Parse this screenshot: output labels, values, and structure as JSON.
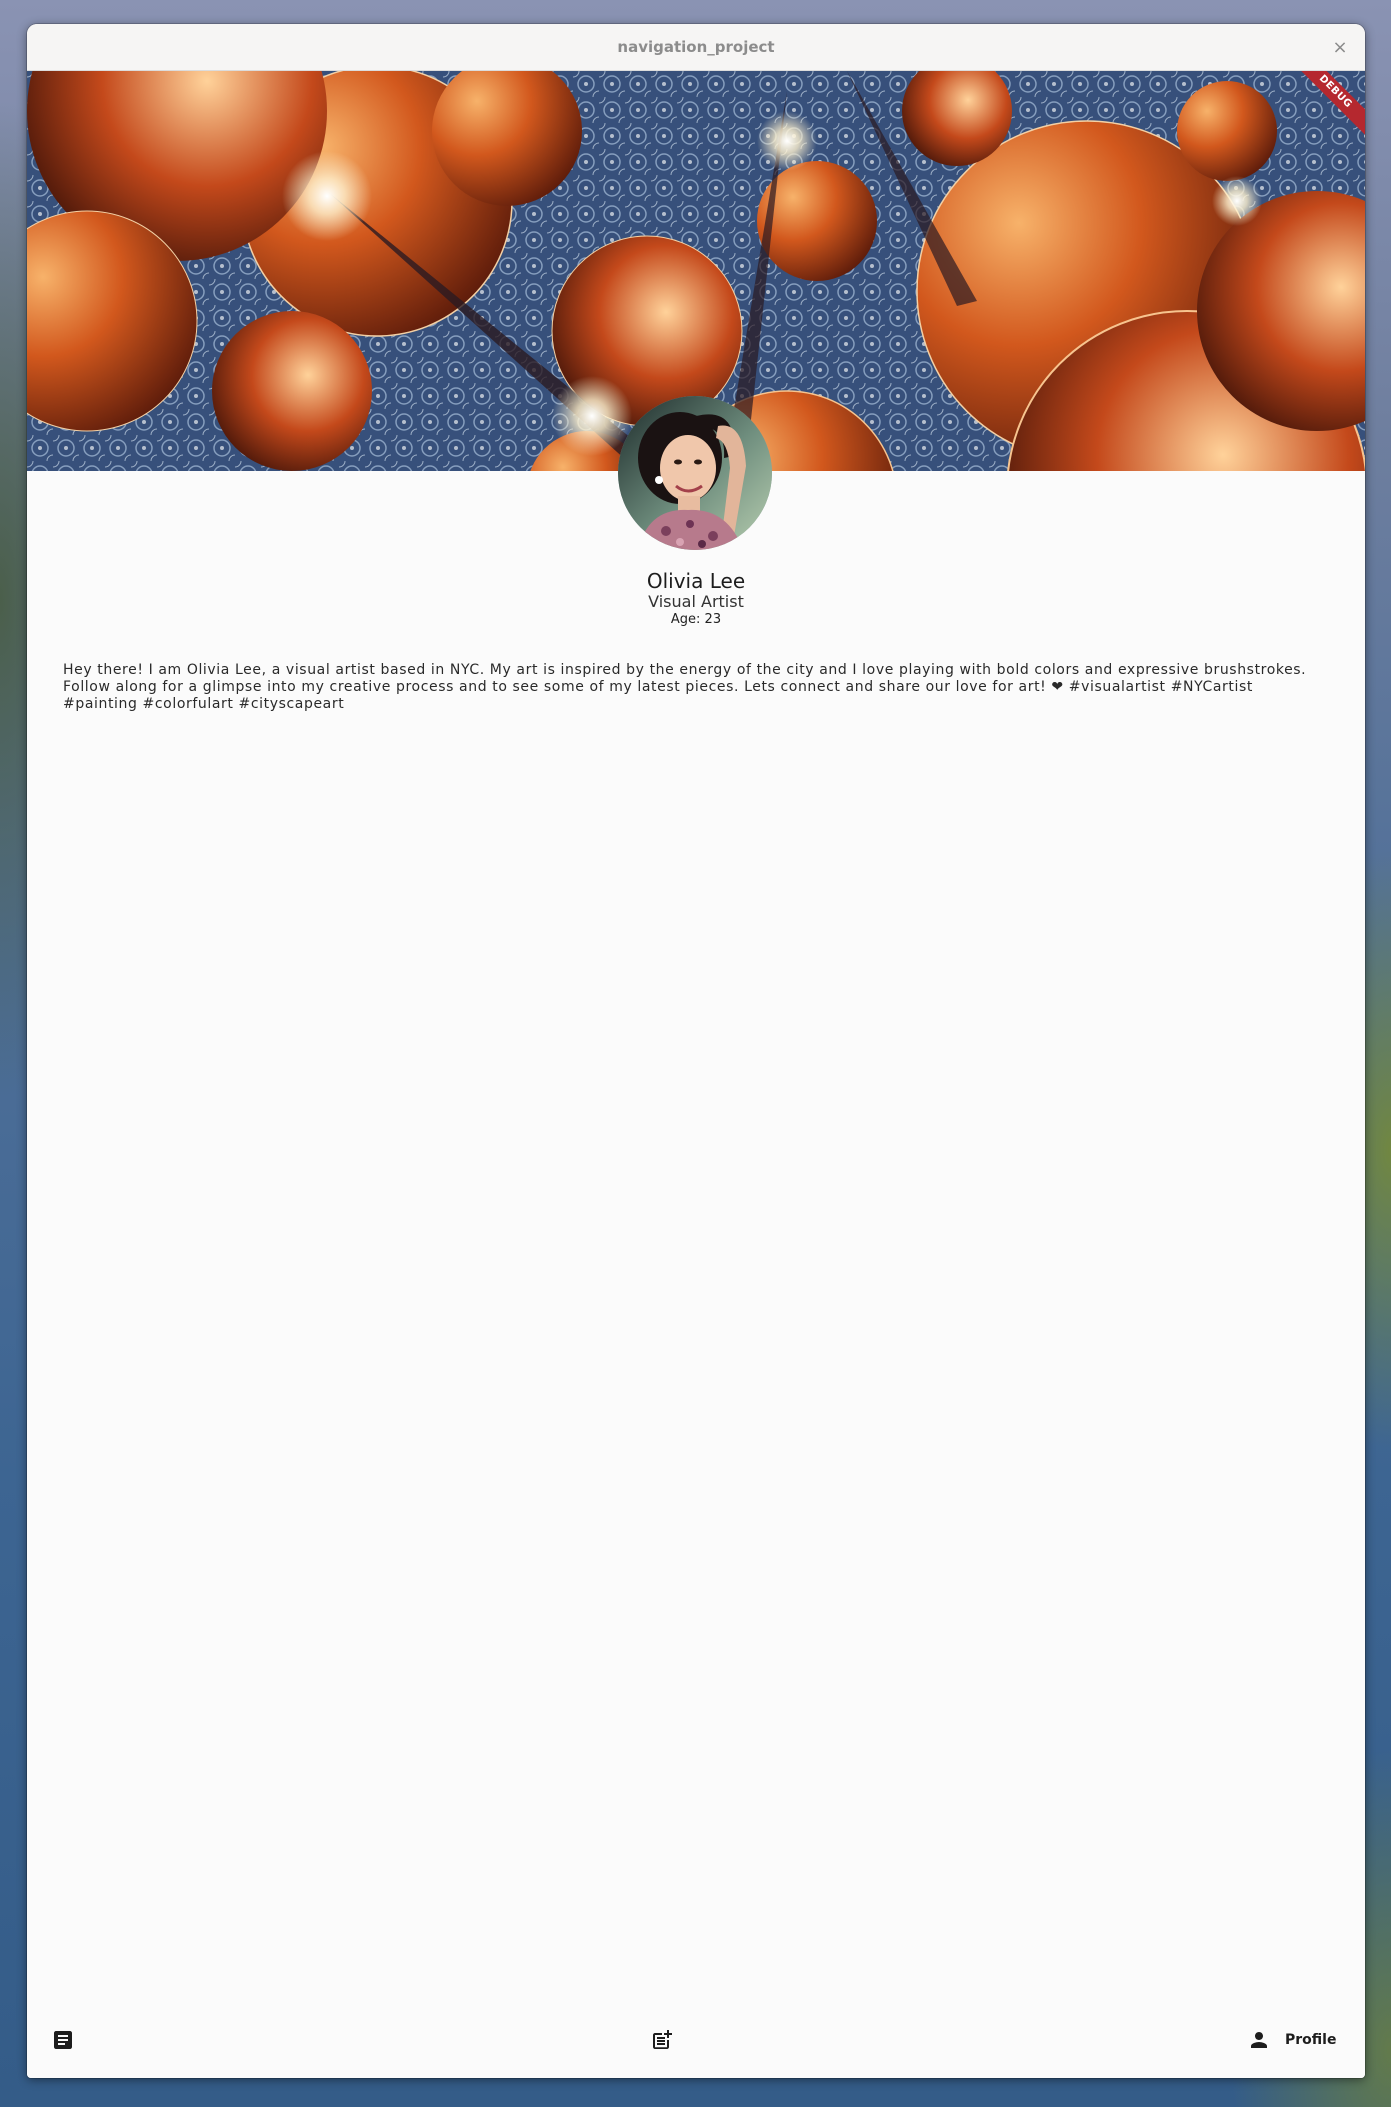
{
  "window": {
    "title": "navigation_project",
    "close_glyph": "×"
  },
  "banner": {
    "debug_label": "DEBUG"
  },
  "profile": {
    "name": "Olivia Lee",
    "role": "Visual Artist",
    "age_text": "Age: 23",
    "bio": "Hey there! I am Olivia Lee, a visual artist based in NYC. My art is inspired by the energy of the city and I love playing with bold colors and expressive brushstrokes. Follow along for a glimpse into my creative process and to see some of my latest pieces. Lets connect and share our love for art! ❤ #visualartist #NYCartist #painting #colorfulart #cityscapeart"
  },
  "bottom_nav": {
    "items": [
      {
        "icon": "article-icon",
        "label": ""
      },
      {
        "icon": "post-add-icon",
        "label": ""
      },
      {
        "icon": "person-icon",
        "label": "Profile"
      }
    ]
  },
  "colors": {
    "debug_ribbon": "#b5282f",
    "window_bg": "#fbfbfb",
    "titlebar_bg": "#f6f5f4"
  }
}
